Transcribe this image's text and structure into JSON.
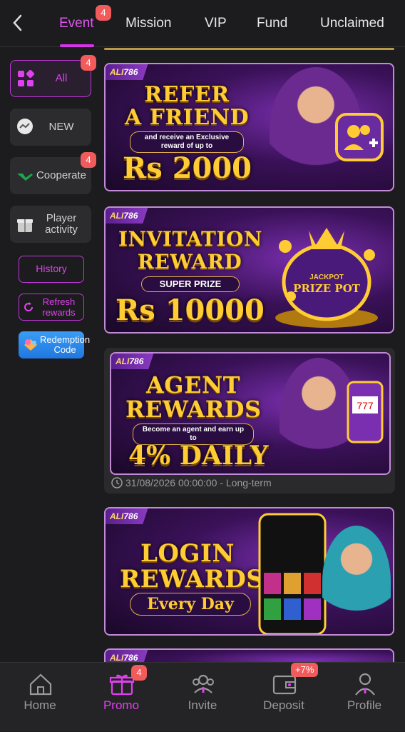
{
  "header": {
    "tabs": [
      {
        "label": "Event",
        "active": true,
        "badge": "4"
      },
      {
        "label": "Mission"
      },
      {
        "label": "VIP"
      },
      {
        "label": "Fund"
      },
      {
        "label": "Unclaimed"
      }
    ]
  },
  "sidebar": {
    "items": [
      {
        "label": "All",
        "badge": "4",
        "active": true,
        "icon": "grid-icon"
      },
      {
        "label": "NEW",
        "icon": "chat-bubble-icon"
      },
      {
        "label": "Cooperate",
        "badge": "4",
        "icon": "handshake-icon"
      },
      {
        "label": "Player activity",
        "icon": "gift-box-icon"
      }
    ],
    "history_label": "History",
    "refresh_label": "Refresh rewards",
    "redeem_label": "Redemption Code"
  },
  "banners": [
    {
      "brand_a": "ALI",
      "brand_b": "786",
      "line1": "REFER",
      "line2": "A FRIEND",
      "sub": "and receive an Exclusive reward of up to",
      "big": "Rs 2000"
    },
    {
      "brand_a": "ALI",
      "brand_b": "786",
      "line1": "INVITATION",
      "line2": "REWARD",
      "sub": "SUPER PRIZE",
      "big": "Rs 10000",
      "pot_line1": "JACKPOT",
      "pot_line2": "PRIZE POT"
    },
    {
      "brand_a": "ALI",
      "brand_b": "786",
      "line1": "AGENT",
      "line2": "REWARDS",
      "sub": "Become an agent and earn up to",
      "big": "4% DAILY",
      "date": "31/08/2026 00:00:00 - Long-term"
    },
    {
      "brand_a": "ALI",
      "brand_b": "786",
      "line1": "LOGIN",
      "line2": "REWARDS",
      "sub": "Every Day"
    },
    {
      "brand_a": "ALI",
      "brand_b": "786"
    }
  ],
  "tabbar": {
    "items": [
      {
        "label": "Home",
        "icon": "home-icon"
      },
      {
        "label": "Promo",
        "icon": "gift-icon",
        "active": true,
        "badge": "4"
      },
      {
        "label": "Invite",
        "icon": "people-icon"
      },
      {
        "label": "Deposit",
        "icon": "wallet-icon",
        "badge": "+7%"
      },
      {
        "label": "Profile",
        "icon": "person-icon"
      }
    ]
  },
  "colors": {
    "accent": "#e040f0",
    "badge": "#f25b5b",
    "bg": "#1c1c1e",
    "gold": "#ffcc33"
  }
}
